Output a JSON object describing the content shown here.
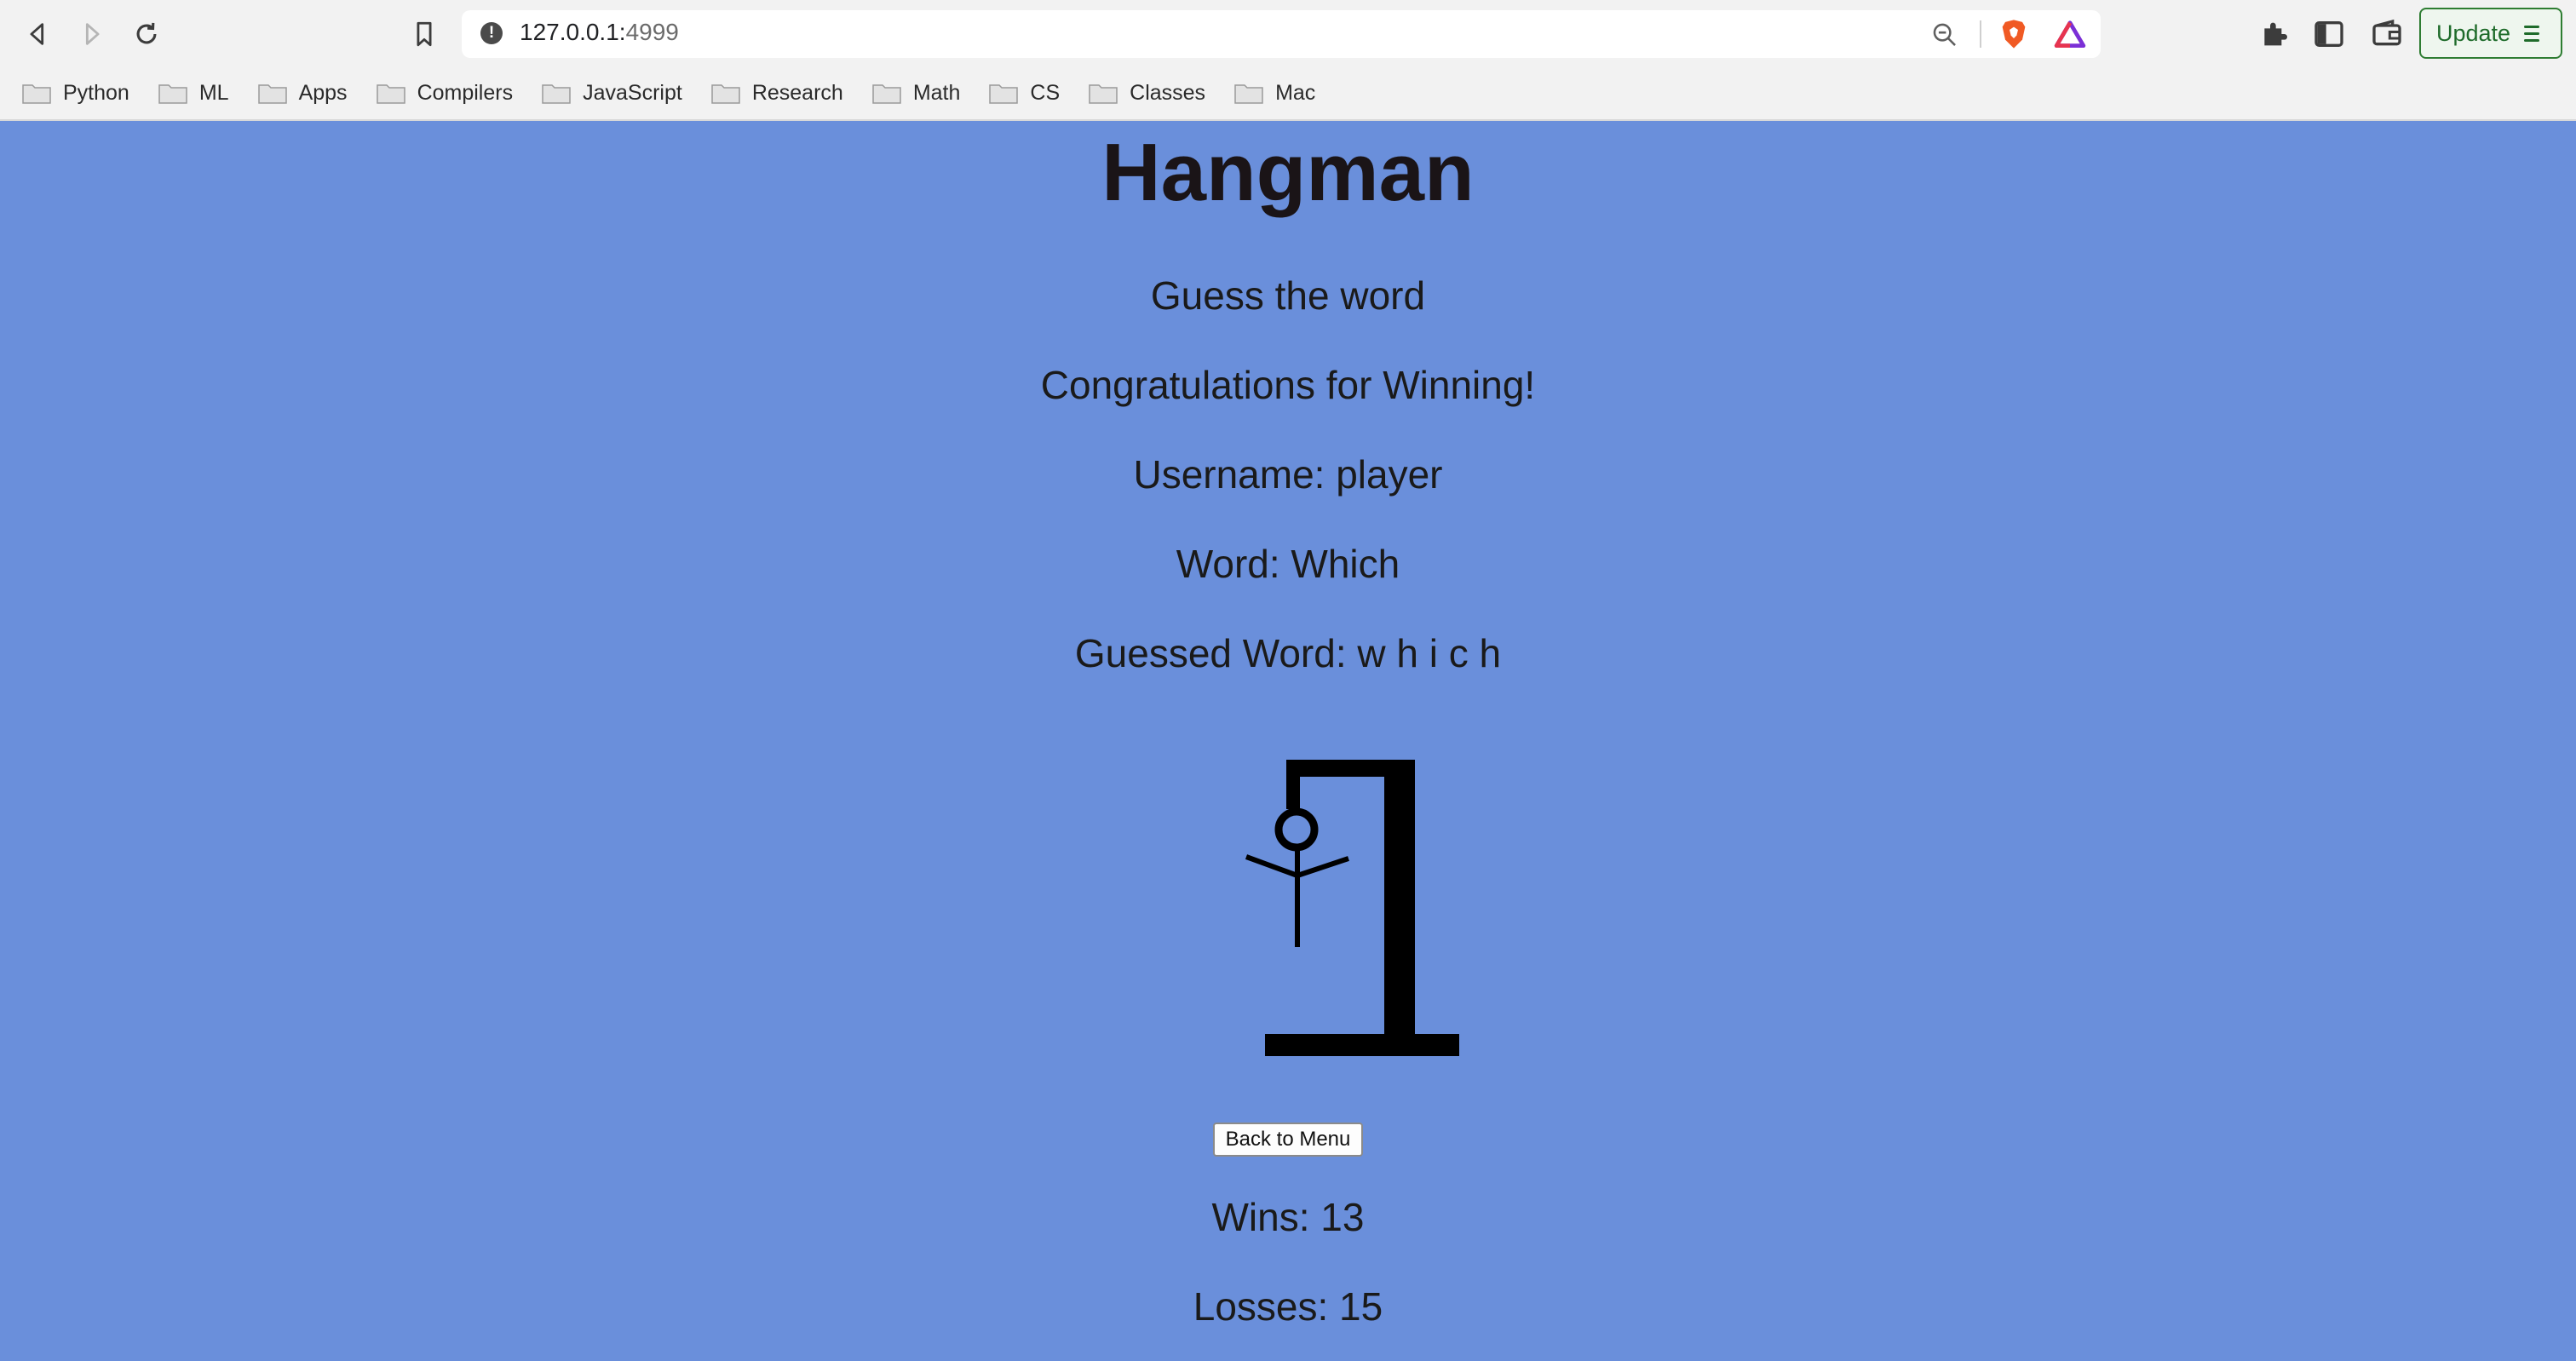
{
  "browser": {
    "url_host": "127.0.0.1:",
    "url_port": "4999",
    "update_label": "Update",
    "bookmarks": [
      "Python",
      "ML",
      "Apps",
      "Compilers",
      "JavaScript",
      "Research",
      "Math",
      "CS",
      "Classes",
      "Mac"
    ]
  },
  "page": {
    "title": "Hangman",
    "prompt": "Guess the word",
    "message": "Congratulations for Winning!",
    "username_label": "Username: player",
    "word_label": "Word: Which",
    "guessed_label": "Guessed Word: w h i c h",
    "back_button": "Back to Menu",
    "wins_label": "Wins: 13",
    "losses_label": "Losses: 15"
  },
  "colors": {
    "page_background": "#6a8fdb",
    "update_accent": "#2e7d32"
  }
}
